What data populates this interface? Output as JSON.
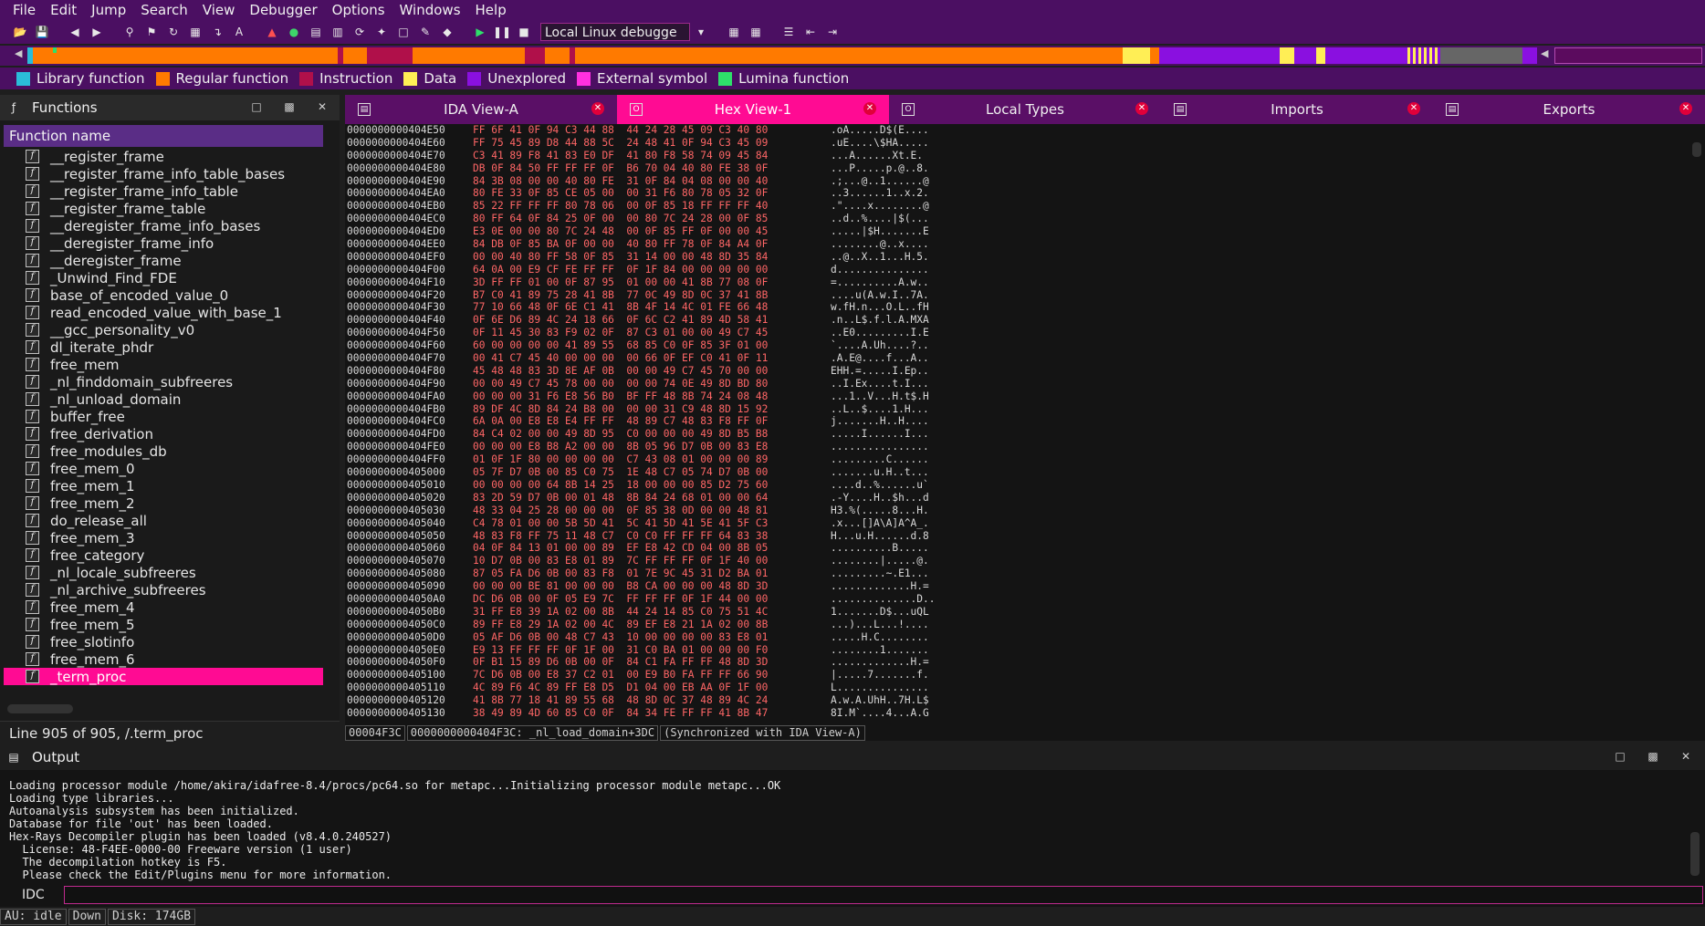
{
  "menubar": [
    "File",
    "Edit",
    "Jump",
    "Search",
    "View",
    "Debugger",
    "Options",
    "Windows",
    "Help"
  ],
  "toolbar": {
    "debugger_select": "Local Linux debugge",
    "icons": [
      "open-icon",
      "save-icon",
      "back-icon",
      "forward-icon",
      "search-icon",
      "bookmark-icon",
      "jump-icon",
      "code-icon",
      "text-icon",
      "breakpoint-icon",
      "run-icon",
      "pause-icon",
      "stop-icon",
      "calc-icon",
      "graph-icon",
      "list-icon"
    ]
  },
  "legend": [
    {
      "label": "Library function",
      "color": "#2bbcd8"
    },
    {
      "label": "Regular function",
      "color": "#ff7a00"
    },
    {
      "label": "Instruction",
      "color": "#b0104a"
    },
    {
      "label": "Data",
      "color": "#ffee55"
    },
    {
      "label": "Unexplored",
      "color": "#8a10e0"
    },
    {
      "label": "External symbol",
      "color": "#ff30e0"
    },
    {
      "label": "Lumina function",
      "color": "#2ee06a"
    }
  ],
  "functions": {
    "title": "Functions",
    "column_header": "Function name",
    "items": [
      "__register_frame",
      "__register_frame_info_table_bases",
      "__register_frame_info_table",
      "__register_frame_table",
      "__deregister_frame_info_bases",
      "__deregister_frame_info",
      "__deregister_frame",
      "_Unwind_Find_FDE",
      "base_of_encoded_value_0",
      "read_encoded_value_with_base_1",
      "__gcc_personality_v0",
      "dl_iterate_phdr",
      "free_mem",
      "_nl_finddomain_subfreeres",
      "_nl_unload_domain",
      "buffer_free",
      "free_derivation",
      "free_modules_db",
      "free_mem_0",
      "free_mem_1",
      "free_mem_2",
      "do_release_all",
      "free_mem_3",
      "free_category",
      "_nl_locale_subfreeres",
      "_nl_archive_subfreeres",
      "free_mem_4",
      "free_mem_5",
      "free_slotinfo",
      "free_mem_6",
      "_term_proc"
    ],
    "selected_index": 30,
    "status": "Line 905 of 905, /.term_proc"
  },
  "tabs": [
    {
      "label": "IDA View-A",
      "active": false
    },
    {
      "label": "Hex View-1",
      "active": true
    },
    {
      "label": "Local Types",
      "active": false
    },
    {
      "label": "Imports",
      "active": false
    },
    {
      "label": "Exports",
      "active": false
    }
  ],
  "hex": {
    "rows": [
      [
        "0000000000404E50",
        "FF 6F 41 0F 94 C3 44 88  44 24 28 45 09 C3 40 80",
        ".oA.....D$(E...."
      ],
      [
        "0000000000404E60",
        "FF 75 45 89 D8 44 88 5C  24 48 41 0F 94 C3 45 09",
        ".uE....\\$HA....."
      ],
      [
        "0000000000404E70",
        "C3 41 89 F8 41 83 E0 DF  41 80 F8 58 74 09 45 84",
        "...A......Xt.E."
      ],
      [
        "0000000000404E80",
        "DB 0F 84 50 FF FF FF 0F  B6 70 04 40 80 FE 38 0F",
        "...P.....p.@..8."
      ],
      [
        "0000000000404E90",
        "84 3B 08 00 00 40 80 FE  31 0F 84 04 08 00 00 40",
        ".;...@..1......@"
      ],
      [
        "0000000000404EA0",
        "80 FE 33 0F 85 CE 05 00  00 31 F6 80 78 05 32 0F",
        "..3......1..x.2."
      ],
      [
        "0000000000404EB0",
        "85 22 FF FF FF 80 78 06  00 0F 85 18 FF FF FF 40",
        ".\"....x........@"
      ],
      [
        "0000000000404EC0",
        "80 FF 64 0F 84 25 0F 00  00 80 7C 24 28 00 0F 85",
        "..d..%....|$(..."
      ],
      [
        "0000000000404ED0",
        "E3 0E 00 00 80 7C 24 48  00 0F 85 FF 0F 00 00 45",
        ".....|$H.......E"
      ],
      [
        "0000000000404EE0",
        "84 DB 0F 85 BA 0F 00 00  40 80 FF 78 0F 84 A4 0F",
        "........@..x...."
      ],
      [
        "0000000000404EF0",
        "00 00 40 80 FF 58 0F 85  31 14 00 00 48 8D 35 84",
        "..@..X..1...H.5."
      ],
      [
        "0000000000404F00",
        "64 0A 00 E9 CF FE FF FF  0F 1F 84 00 00 00 00 00",
        "d..............."
      ],
      [
        "0000000000404F10",
        "3D FF FF 01 00 0F 87 95  01 00 00 41 8B 77 08 0F",
        "=..........A.w.."
      ],
      [
        "0000000000404F20",
        "B7 C0 41 89 75 28 41 8B  77 0C 49 8D 0C 37 41 8B",
        "....u(A.w.I..7A."
      ],
      [
        "0000000000404F30",
        "77 10 66 48 0F 6E C1 41  8B 4F 14 4C 01 FE 66 48",
        "w.fH.n...O.L..fH"
      ],
      [
        "0000000000404F40",
        "0F 6E D6 89 4C 24 18 66  0F 6C C2 41 89 4D 58 41",
        ".n..L$.f.l.A.MXA"
      ],
      [
        "0000000000404F50",
        "0F 11 45 30 83 F9 02 0F  87 C3 01 00 00 49 C7 45",
        "..E0.........I.E"
      ],
      [
        "0000000000404F60",
        "60 00 00 00 00 41 89 55  68 85 C0 0F 85 3F 01 00",
        "`....A.Uh....?.."
      ],
      [
        "0000000000404F70",
        "00 41 C7 45 40 00 00 00  00 66 0F EF C0 41 0F 11",
        ".A.E@....f...A.."
      ],
      [
        "0000000000404F80",
        "45 48 48 83 3D 8E AF 0B  00 00 49 C7 45 70 00 00",
        "EHH.=.....I.Ep.."
      ],
      [
        "0000000000404F90",
        "00 00 49 C7 45 78 00 00  00 00 74 0E 49 8D BD 80",
        "..I.Ex....t.I..."
      ],
      [
        "0000000000404FA0",
        "00 00 00 31 F6 E8 56 B0  BF FF 48 8B 74 24 08 48",
        "...1..V...H.t$.H"
      ],
      [
        "0000000000404FB0",
        "89 DF 4C 8D 84 24 B8 00  00 00 31 C9 48 8D 15 92",
        "..L..$....1.H..."
      ],
      [
        "0000000000404FC0",
        "6A 0A 00 E8 E8 E4 FF FF  48 89 C7 48 83 F8 FF 0F",
        "j.......H..H...."
      ],
      [
        "0000000000404FD0",
        "84 C4 02 00 00 49 8D 95  C0 00 00 00 49 8D B5 B8",
        ".....I......I..."
      ],
      [
        "0000000000404FE0",
        "00 00 00 E8 B8 A2 00 00  8B 05 96 D7 0B 00 83 E8",
        "................"
      ],
      [
        "0000000000404FF0",
        "01 0F 1F 80 00 00 00 00  C7 43 08 01 00 00 00 89",
        ".........C......"
      ],
      [
        "0000000000405000",
        "05 7F D7 0B 00 85 C0 75  1E 48 C7 05 74 D7 0B 00",
        ".......u.H..t..."
      ],
      [
        "0000000000405010",
        "00 00 00 00 64 8B 14 25  18 00 00 00 85 D2 75 60",
        "....d..%......u`"
      ],
      [
        "0000000000405020",
        "83 2D 59 D7 0B 00 01 48  8B 84 24 68 01 00 00 64",
        ".-Y....H..$h...d"
      ],
      [
        "0000000000405030",
        "48 33 04 25 28 00 00 00  0F 85 38 0D 00 00 48 81",
        "H3.%(.....8...H."
      ],
      [
        "0000000000405040",
        "C4 78 01 00 00 5B 5D 41  5C 41 5D 41 5E 41 5F C3",
        ".x...[]A\\A]A^A_."
      ],
      [
        "0000000000405050",
        "48 83 F8 FF 75 11 48 C7  C0 C0 FF FF FF 64 83 38",
        "H...u.H......d.8"
      ],
      [
        "0000000000405060",
        "04 0F 84 13 01 00 00 89  EF E8 42 CD 04 00 8B 05",
        "..........B....."
      ],
      [
        "0000000000405070",
        "10 D7 0B 00 83 E8 01 89  7C FF FF FF 0F 1F 40 00",
        "........|.....@."
      ],
      [
        "0000000000405080",
        "87 05 FA D6 0B 00 83 F8  01 7E 9C 45 31 D2 BA 01",
        ".........~.E1..."
      ],
      [
        "0000000000405090",
        "00 00 00 BE 81 00 00 00  B8 CA 00 00 00 48 8D 3D",
        ".............H.="
      ],
      [
        "00000000004050A0",
        "DC D6 0B 00 0F 05 E9 7C  FF FF FF 0F 1F 44 00 00",
        "..............D.."
      ],
      [
        "00000000004050B0",
        "31 FF E8 39 1A 02 00 8B  44 24 14 85 C0 75 51 4C",
        "1.......D$...uQL"
      ],
      [
        "00000000004050C0",
        "89 FF E8 29 1A 02 00 4C  89 EF E8 21 1A 02 00 8B",
        "...)...L...!...."
      ],
      [
        "00000000004050D0",
        "05 AF D6 0B 00 48 C7 43  10 00 00 00 00 83 E8 01",
        ".....H.C........"
      ],
      [
        "00000000004050E0",
        "E9 13 FF FF FF 0F 1F 00  31 C0 BA 01 00 00 00 F0",
        "........1......."
      ],
      [
        "00000000004050F0",
        "0F B1 15 89 D6 0B 00 0F  84 C1 FA FF FF 48 8D 3D",
        ".............H.="
      ],
      [
        "0000000000405100",
        "7C D6 0B 00 E8 37 C2 01  00 E9 B0 FA FF FF 66 90",
        "|.....7.......f."
      ],
      [
        "0000000000405110",
        "4C 89 F6 4C 89 FF E8 D5  D1 04 00 EB AA 0F 1F 00",
        "L..............."
      ],
      [
        "0000000000405120",
        "41 8B 77 18 41 89 55 68  48 8D 0C 37 48 89 4C 24",
        "A.w.A.UhH..7H.L$"
      ],
      [
        "0000000000405130",
        "38 49 89 4D 60 85 C0 0F  84 34 FE FF FF 41 8B 47",
        "8I.M`....4...A.G"
      ]
    ],
    "status_offset": "00004F3C",
    "status_location": "0000000000404F3C: _nl_load_domain+3DC",
    "status_sync": "(Synchronized with IDA View-A)"
  },
  "output": {
    "title": "Output",
    "lines": [
      "Loading processor module /home/akira/idafree-8.4/procs/pc64.so for metapc...Initializing processor module metapc...OK",
      "Loading type libraries...",
      "Autoanalysis subsystem has been initialized.",
      "Database for file 'out' has been loaded.",
      "Hex-Rays Decompiler plugin has been loaded (v8.4.0.240527)",
      "  License: 48-F4EE-0000-00 Freeware version (1 user)",
      "  The decompilation hotkey is F5.",
      "  Please check the Edit/Plugins menu for more information."
    ],
    "idc_label": "IDC",
    "idc_value": ""
  },
  "statusbar": {
    "au": "AU:  idle",
    "direction": "Down",
    "disk": "Disk: 174GB"
  },
  "colors": {
    "menubar_bg": "#4b0f62",
    "selection": "#ff0b93",
    "hex_bytes": "#ff6666",
    "highlight_byte": "#b53cf0"
  }
}
